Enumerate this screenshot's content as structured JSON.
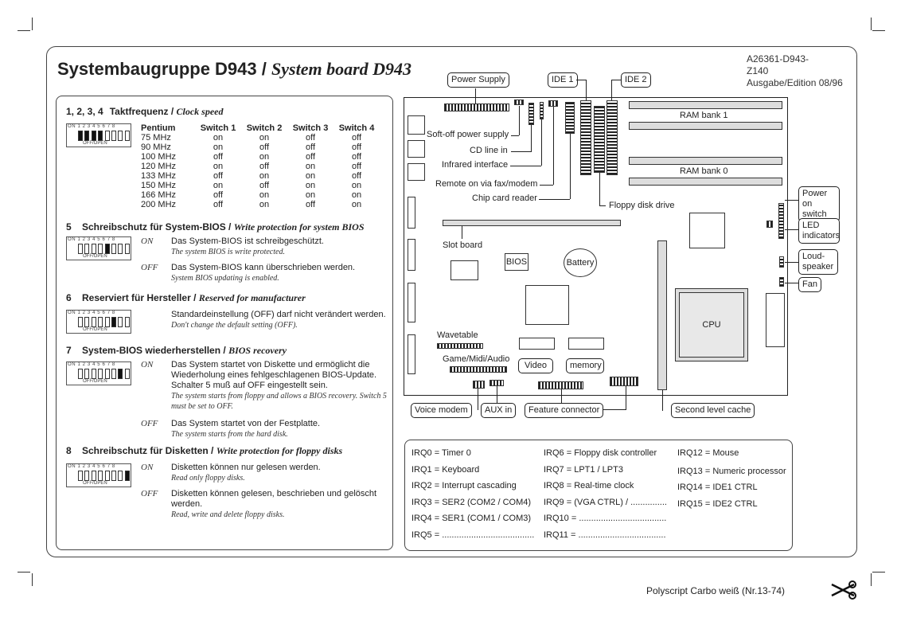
{
  "header": {
    "title_de": "Systembaugruppe D943",
    "separator": "/",
    "title_en": "System board D943",
    "doc_number": "A26361-D943-\nZ140\nAusgabe/Edition 08/96"
  },
  "sections": [
    {
      "num": "1, 2, 3, 4",
      "title_de": "Taktfrequenz",
      "title_en": "Clock speed",
      "highlighted_switches": [
        1,
        2,
        3,
        4
      ]
    },
    {
      "num": "5",
      "title_de": "Schreibschutz für System-BIOS",
      "title_en": "Write protection for system BIOS",
      "highlighted_switches": [
        5
      ],
      "options": [
        {
          "key": "ON",
          "de": "Das System-BIOS ist schreibgeschützt.",
          "en": "The system BIOS is write protected."
        },
        {
          "key": "OFF",
          "de": "Das System-BIOS kann überschrieben werden.",
          "en": "System BIOS updating is enabled."
        }
      ]
    },
    {
      "num": "6",
      "title_de": "Reserviert für Hersteller",
      "title_en": "Reserved for manufacturer",
      "highlighted_switches": [
        6
      ],
      "options": [
        {
          "key": "",
          "de": "Standardeinstellung (OFF) darf nicht verändert werden.",
          "en": "Don't change the default setting (OFF)."
        }
      ]
    },
    {
      "num": "7",
      "title_de": "System-BIOS wiederherstellen",
      "title_en": "BIOS recovery",
      "highlighted_switches": [
        7
      ],
      "options": [
        {
          "key": "ON",
          "de": "Das System startet von Diskette und ermöglicht die Wiederholung eines fehlgeschlagenen BIOS-Update. Schalter 5 muß auf OFF eingestellt sein.",
          "en": "The system starts from floppy and allows a BIOS recovery. Switch 5 must be set to OFF."
        },
        {
          "key": "OFF",
          "de": "Das System startet von der Festplatte.",
          "en": "The system starts from the hard disk."
        }
      ]
    },
    {
      "num": "8",
      "title_de": "Schreibschutz für Disketten",
      "title_en": "Write protection for floppy disks",
      "highlighted_switches": [
        8
      ],
      "options": [
        {
          "key": "ON",
          "de": "Disketten können nur gelesen werden.",
          "en": "Read only floppy disks."
        },
        {
          "key": "OFF",
          "de": "Disketten können gelesen, beschrieben und gelöscht werden.",
          "en": "Read, write and delete floppy disks."
        }
      ]
    }
  ],
  "dip": {
    "on_label": "ON",
    "numbers": "1 2 3 4 5 6 7 8",
    "off_label": "OFF/OPEN"
  },
  "clock_table": {
    "headers": [
      "Pentium",
      "Switch 1",
      "Switch 2",
      "Switch 3",
      "Switch 4"
    ],
    "rows": [
      [
        "75 MHz",
        "on",
        "on",
        "off",
        "off"
      ],
      [
        "90 MHz",
        "on",
        "off",
        "off",
        "off"
      ],
      [
        "100 MHz",
        "off",
        "on",
        "off",
        "off"
      ],
      [
        "120 MHz",
        "on",
        "off",
        "on",
        "off"
      ],
      [
        "133 MHz",
        "off",
        "on",
        "on",
        "off"
      ],
      [
        "150 MHz",
        "on",
        "off",
        "on",
        "on"
      ],
      [
        "166 MHz",
        "off",
        "on",
        "on",
        "on"
      ],
      [
        "200 MHz",
        "off",
        "on",
        "off",
        "on"
      ]
    ]
  },
  "board": {
    "power_supply": "Power Supply",
    "ide1": "IDE 1",
    "ide2": "IDE 2",
    "soft_off": "Soft-off power supply",
    "cd_line": "CD line in",
    "infrared": "Infrared interface",
    "remote_on": "Remote on via fax/modem",
    "chip_card": "Chip card reader",
    "floppy": "Floppy disk drive",
    "ram1": "RAM bank 1",
    "ram0": "RAM bank 0",
    "power_on_switch": "Power on switch",
    "led": "LED indicators",
    "loudspeaker": "Loud-speaker",
    "fan": "Fan",
    "slot_board": "Slot board",
    "bios": "BIOS",
    "battery": "Battery",
    "cpu": "CPU",
    "wavetable": "Wavetable",
    "game_midi": "Game/Midi/Audio",
    "video": "Video",
    "memory": "memory",
    "voice_modem": "Voice modem",
    "aux_in": "AUX in",
    "feature_connector": "Feature connector",
    "second_level_cache": "Second level cache"
  },
  "irq": {
    "col1": [
      "IRQ0 = Timer 0",
      "IRQ1 = Keyboard",
      "IRQ2 = Interrupt cascading",
      "IRQ3 = SER2 (COM2 / COM4)",
      "IRQ4 = SER1 (COM1 / COM3)",
      "IRQ5 = ......................................"
    ],
    "col2": [
      "IRQ6 = Floppy disk controller",
      "IRQ7 = LPT1 / LPT3",
      "IRQ8 = Real-time clock",
      "IRQ9 = (VGA CTRL) / ...............",
      "IRQ10 = ....................................",
      "IRQ11 = ...................................."
    ],
    "col3": [
      "IRQ12 = Mouse",
      "IRQ13 = Numeric processor",
      "IRQ14 = IDE1 CTRL",
      "IRQ15 = IDE2 CTRL"
    ]
  },
  "footer": {
    "paper": "Polyscript Carbo weiß (Nr.13-74)",
    "scissors_icon": "scissors-icon"
  }
}
